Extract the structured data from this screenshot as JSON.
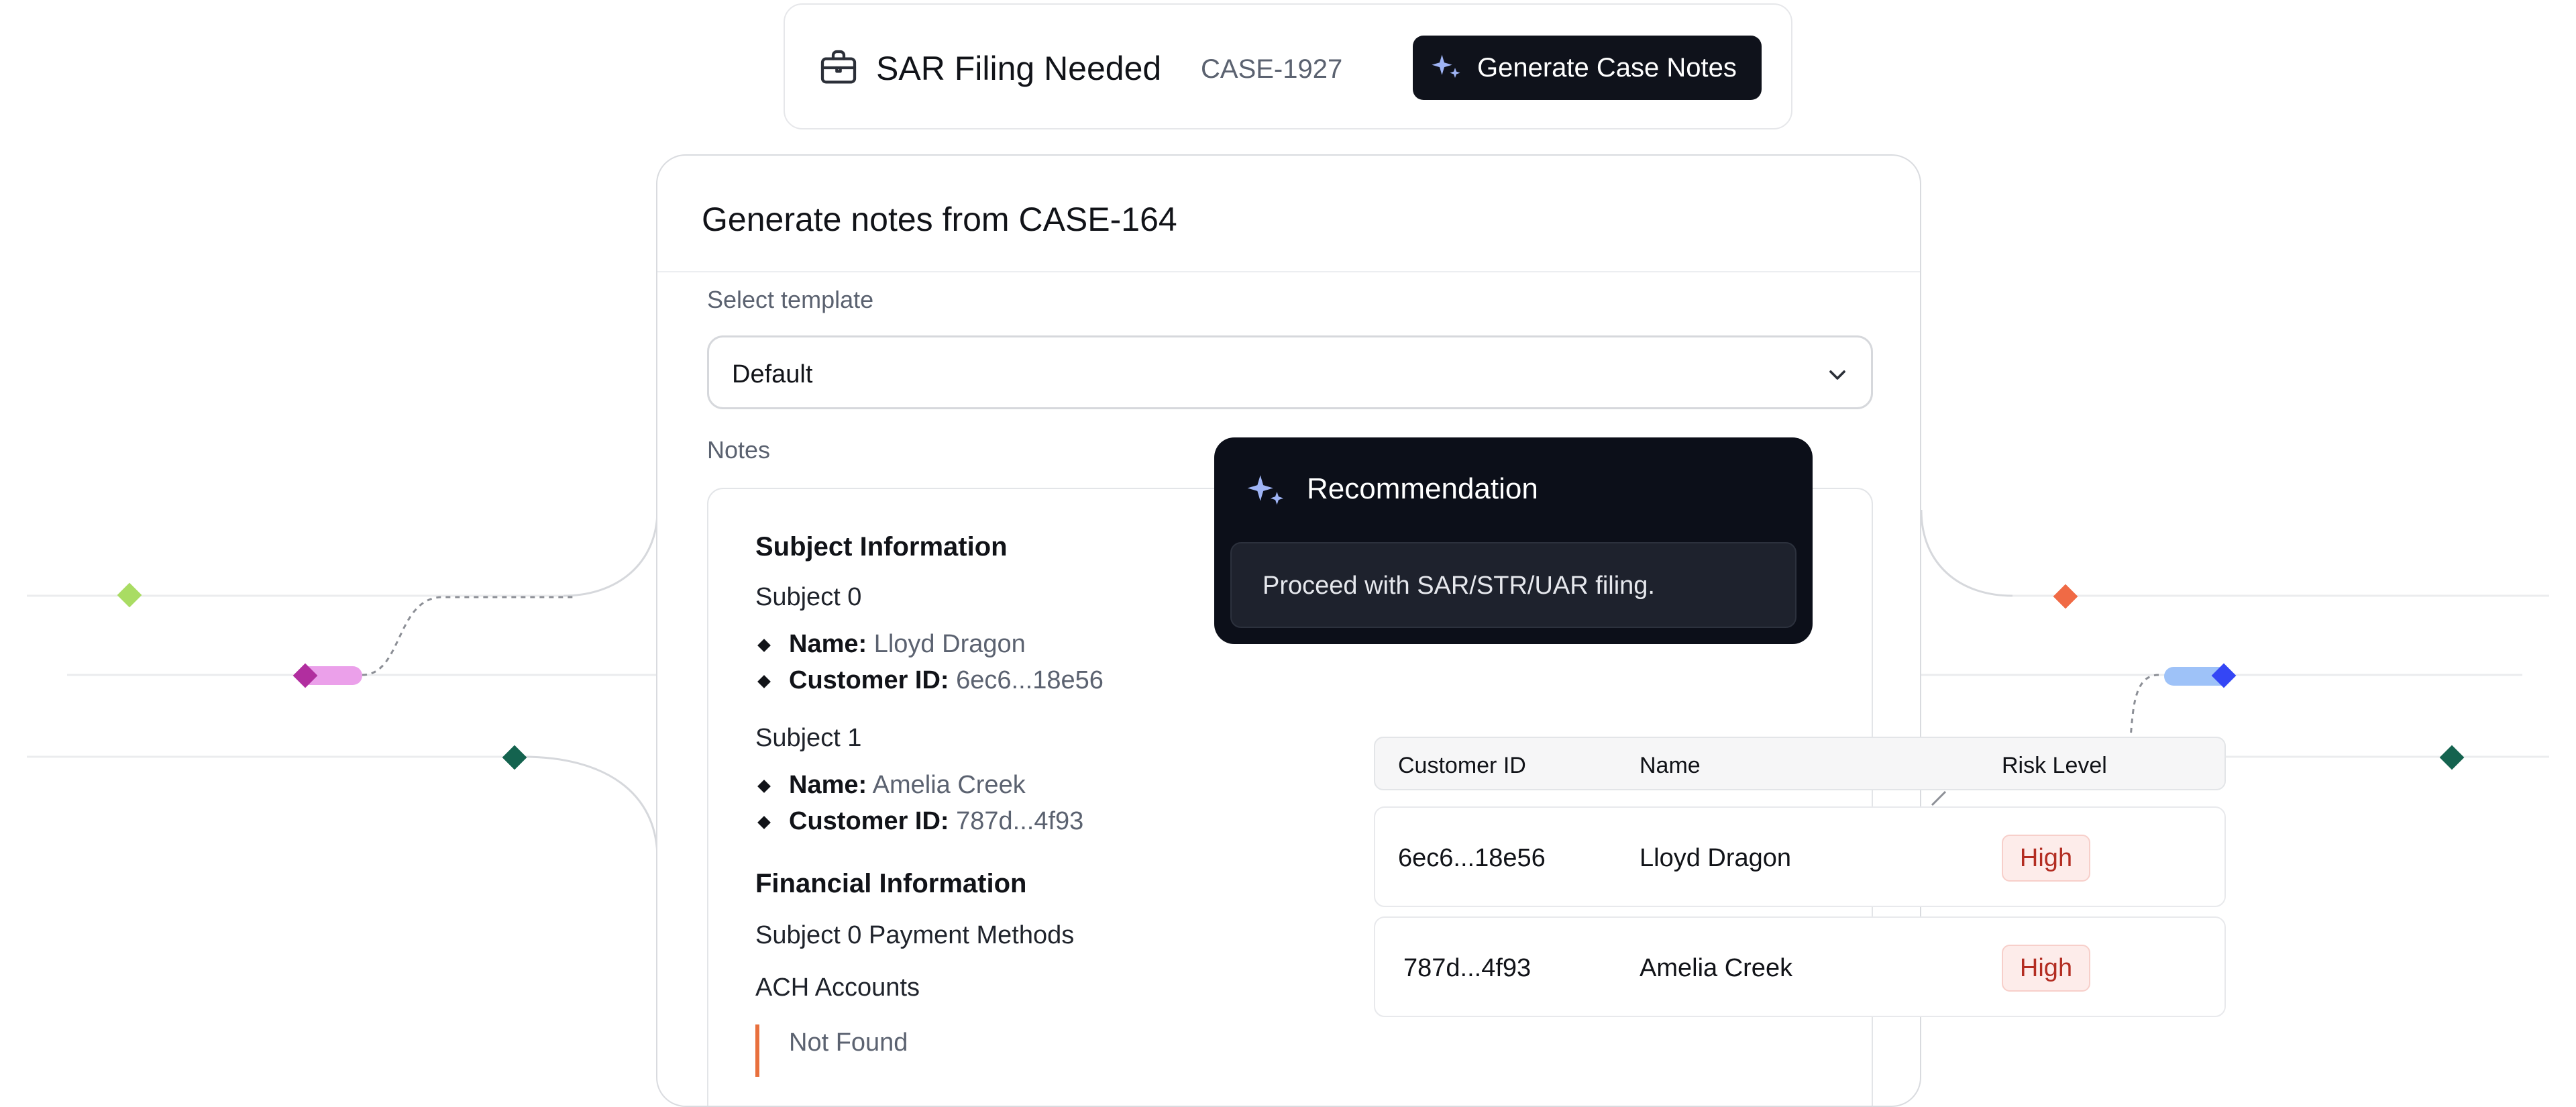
{
  "header": {
    "title": "SAR Filing Needed",
    "case_id": "CASE-1927",
    "generate_button": "Generate Case Notes"
  },
  "card": {
    "title": "Generate notes from CASE-164",
    "select_label": "Select template",
    "select_value": "Default",
    "notes_label": "Notes",
    "notes": {
      "subject_heading": "Subject Information",
      "subjects": [
        {
          "label": "Subject 0",
          "name_key": "Name:",
          "name": "Lloyd Dragon",
          "id_key": "Customer ID:",
          "id": "6ec6...18e56"
        },
        {
          "label": "Subject 1",
          "name_key": "Name:",
          "name": "Amelia Creek",
          "id_key": "Customer ID:",
          "id": "787d...4f93"
        }
      ],
      "financial_heading": "Financial Information",
      "payment_methods": "Subject 0 Payment Methods",
      "ach_heading": "ACH Accounts",
      "ach_value": "Not Found"
    }
  },
  "recommendation": {
    "title": "Recommendation",
    "text": "Proceed with SAR/STR/UAR filing."
  },
  "table": {
    "headers": [
      "Customer ID",
      "Name",
      "Risk Level"
    ],
    "rows": [
      {
        "id": "6ec6...18e56",
        "name": "Lloyd Dragon",
        "risk": "High"
      },
      {
        "id": "787d...4f93",
        "name": "Amelia Creek",
        "risk": "High"
      }
    ]
  },
  "colors": {
    "accent_dark": "#0f121b",
    "sparkle": "#9fb4f5",
    "risk_high": "#b32d22",
    "node_lime": "#a9dc63",
    "node_magenta": "#b12e9f",
    "node_pink": "#eba0ea",
    "node_teal": "#14634f",
    "node_orange": "#f06a45",
    "node_blue": "#3446f5",
    "node_lightblue": "#9ec2f8"
  }
}
